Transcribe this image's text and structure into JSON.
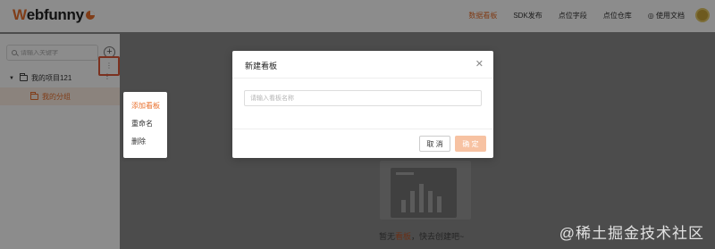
{
  "header": {
    "logo_main": "ebfunny",
    "logo_w": "W",
    "nav": [
      {
        "label": "数据看板",
        "active": true
      },
      {
        "label": "SDK发布",
        "active": false
      },
      {
        "label": "点位字段",
        "active": false
      },
      {
        "label": "点位仓库",
        "active": false
      },
      {
        "label": "使用文档",
        "active": false
      }
    ]
  },
  "sidebar": {
    "search_placeholder": "请输入关键字",
    "project_label": "我的项目121",
    "group_label": "我的分组",
    "more_symbol": "⋮"
  },
  "context_menu": {
    "items": [
      "添加看板",
      "重命名",
      "删除"
    ]
  },
  "modal": {
    "title": "新建看板",
    "close_symbol": "✕",
    "input_placeholder": "请输入看板名称",
    "cancel_label": "取 消",
    "ok_label": "确 定"
  },
  "empty": {
    "prefix": "暂无",
    "highlight": "看板",
    "suffix": "，快去创建吧~"
  },
  "watermark": "@稀土掘金技术社区",
  "colors": {
    "accent": "#e9702d",
    "overlay": "#8a8a8a",
    "ok_disabled": "#f7c2a2"
  }
}
